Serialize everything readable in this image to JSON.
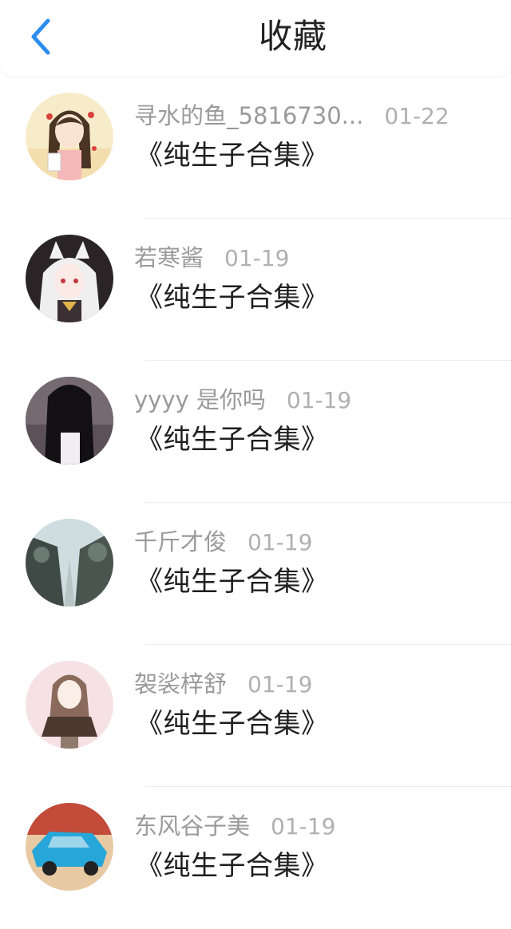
{
  "header": {
    "title": "收藏",
    "back_icon": "chevron-left-icon",
    "accent_color": "#2d8cf0"
  },
  "items": [
    {
      "user": "寻水的鱼_5816730...",
      "date": "01-22",
      "collection": "《纯生子合集》",
      "avatar_icon": "avatar-girl-braids"
    },
    {
      "user": "若寒酱",
      "date": "01-19",
      "collection": "《纯生子合集》",
      "avatar_icon": "avatar-fox-girl"
    },
    {
      "user": "yyyy 是你吗",
      "date": "01-19",
      "collection": "《纯生子合集》",
      "avatar_icon": "avatar-dark-hair"
    },
    {
      "user": "千斤才俊",
      "date": "01-19",
      "collection": "《纯生子合集》",
      "avatar_icon": "avatar-trees"
    },
    {
      "user": "袈裟梓舒",
      "date": "01-19",
      "collection": "《纯生子合集》",
      "avatar_icon": "avatar-sketch-girl"
    },
    {
      "user": "东风谷子美",
      "date": "01-19",
      "collection": "《纯生子合集》",
      "avatar_icon": "avatar-blue-car"
    }
  ]
}
